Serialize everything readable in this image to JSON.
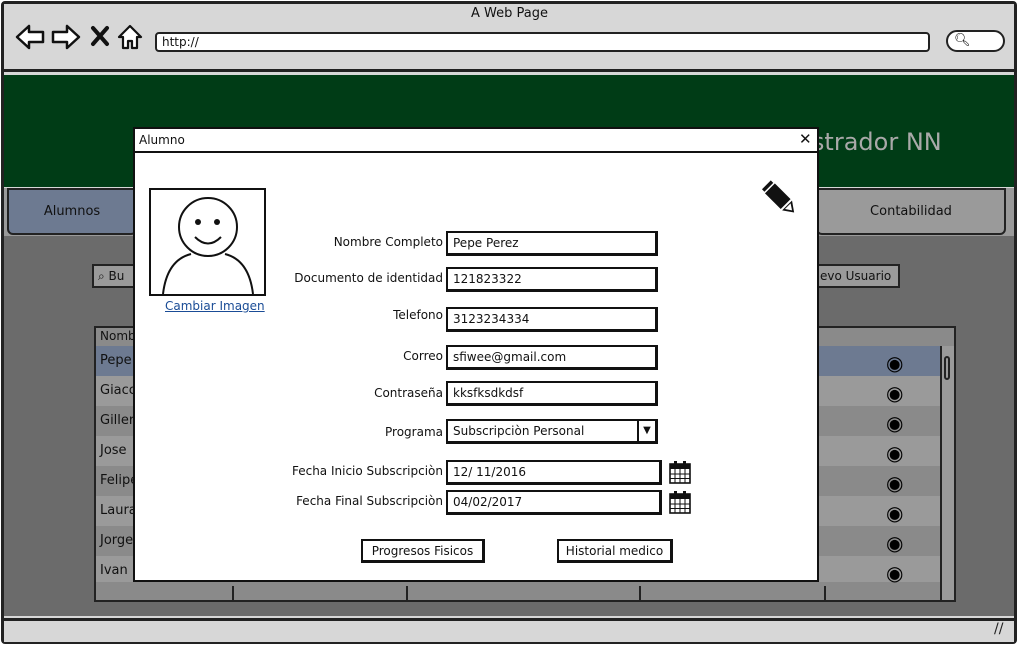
{
  "window": {
    "title": "A Web Page",
    "url": "http://",
    "nav_icons": [
      "back-arrow-icon",
      "forward-arrow-icon",
      "close-icon",
      "home-icon"
    ]
  },
  "app": {
    "header_title": "ministrador NN",
    "header_color": "#003c16",
    "nav_tabs": {
      "alumnos": "Alumnos",
      "contabilidad": "Contabilidad"
    },
    "search_placeholder": "Bu",
    "new_user_label": "evo Usuario",
    "table_header_first": "Nomb",
    "rows": [
      "Pepe",
      "Giacc",
      "Giller",
      "Jose",
      "Felipe",
      "Laura",
      "Jorge",
      "Ivan F"
    ]
  },
  "modal": {
    "title": "Alumno",
    "change_image_label": "Cambiar Imagen",
    "fields": {
      "nombre_label": "Nombre Completo",
      "nombre_value": "Pepe Perez",
      "documento_label": "Documento de identidad",
      "documento_value": "121823322",
      "telefono_label": "Telefono",
      "telefono_value": "3123234334",
      "correo_label": "Correo",
      "correo_value": "sfiwee@gmail.com",
      "contrasena_label": "Contraseña",
      "contrasena_value": "kksfksdkdsf",
      "programa_label": "Programa",
      "programa_value": "Subscripciòn Personal",
      "fecha_inicio_label": "Fecha Inicio Subscripciòn",
      "fecha_inicio_value": "12/ 11/2016",
      "fecha_final_label": "Fecha Final Subscripciòn",
      "fecha_final_value": "04/02/2017"
    },
    "buttons": {
      "progresos": "Progresos Fisicos",
      "historial": "Historial medico"
    }
  }
}
